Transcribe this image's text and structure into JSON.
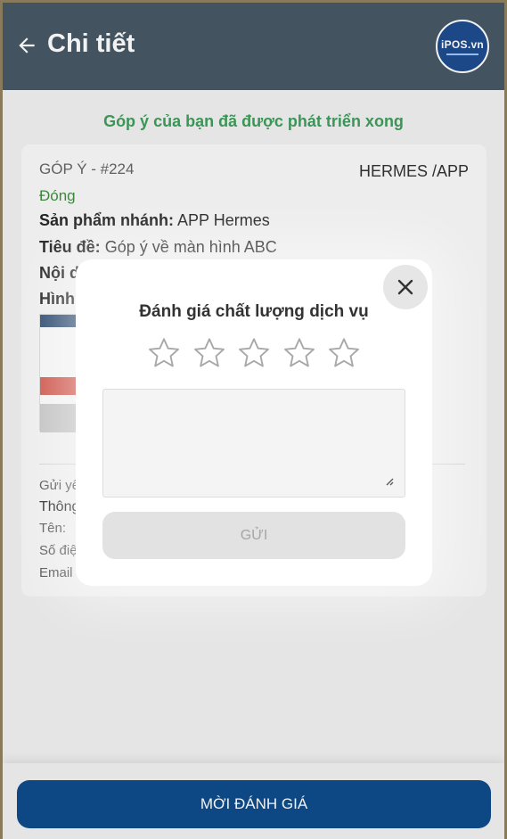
{
  "header": {
    "title": "Chi tiết",
    "logo_text": "iPOS.vn",
    "back_icon": "arrow-left-icon"
  },
  "status_banner": "Góp ý của bạn đã được phát triển xong",
  "ticket": {
    "id": "GÓP Ý - #224",
    "product_tag": "HERMES /APP",
    "status": "Đóng",
    "status_color": "#3f8f3f",
    "branch_label": "Sản phẩm nhánh:",
    "branch_value": " APP Hermes",
    "title_label": "Tiêu đề:",
    "title_value": " Góp ý về màn hình ABC",
    "content_label": "Nội d",
    "image_label": "Hình",
    "sent_label": "Gửi yê",
    "info_label": "Thông",
    "name_label": "Tên:",
    "phone_label": "Số điệ",
    "email_label": "Email"
  },
  "rating_modal": {
    "title": "Đánh giá chất lượng dịch vụ",
    "stars_max": 5,
    "stars_selected": 0,
    "comment_value": "",
    "comment_placeholder": "",
    "send_label": "GỬI",
    "close_icon": "close-icon",
    "star_icon": "star-outline-icon"
  },
  "bottom": {
    "invite_label": "MỜI ĐÁNH GIÁ"
  },
  "colors": {
    "header_bg": "#475866",
    "banner_green": "#3f9d5b",
    "primary_button": "#0e4c8c",
    "disabled_button": "#e2e2e2"
  }
}
